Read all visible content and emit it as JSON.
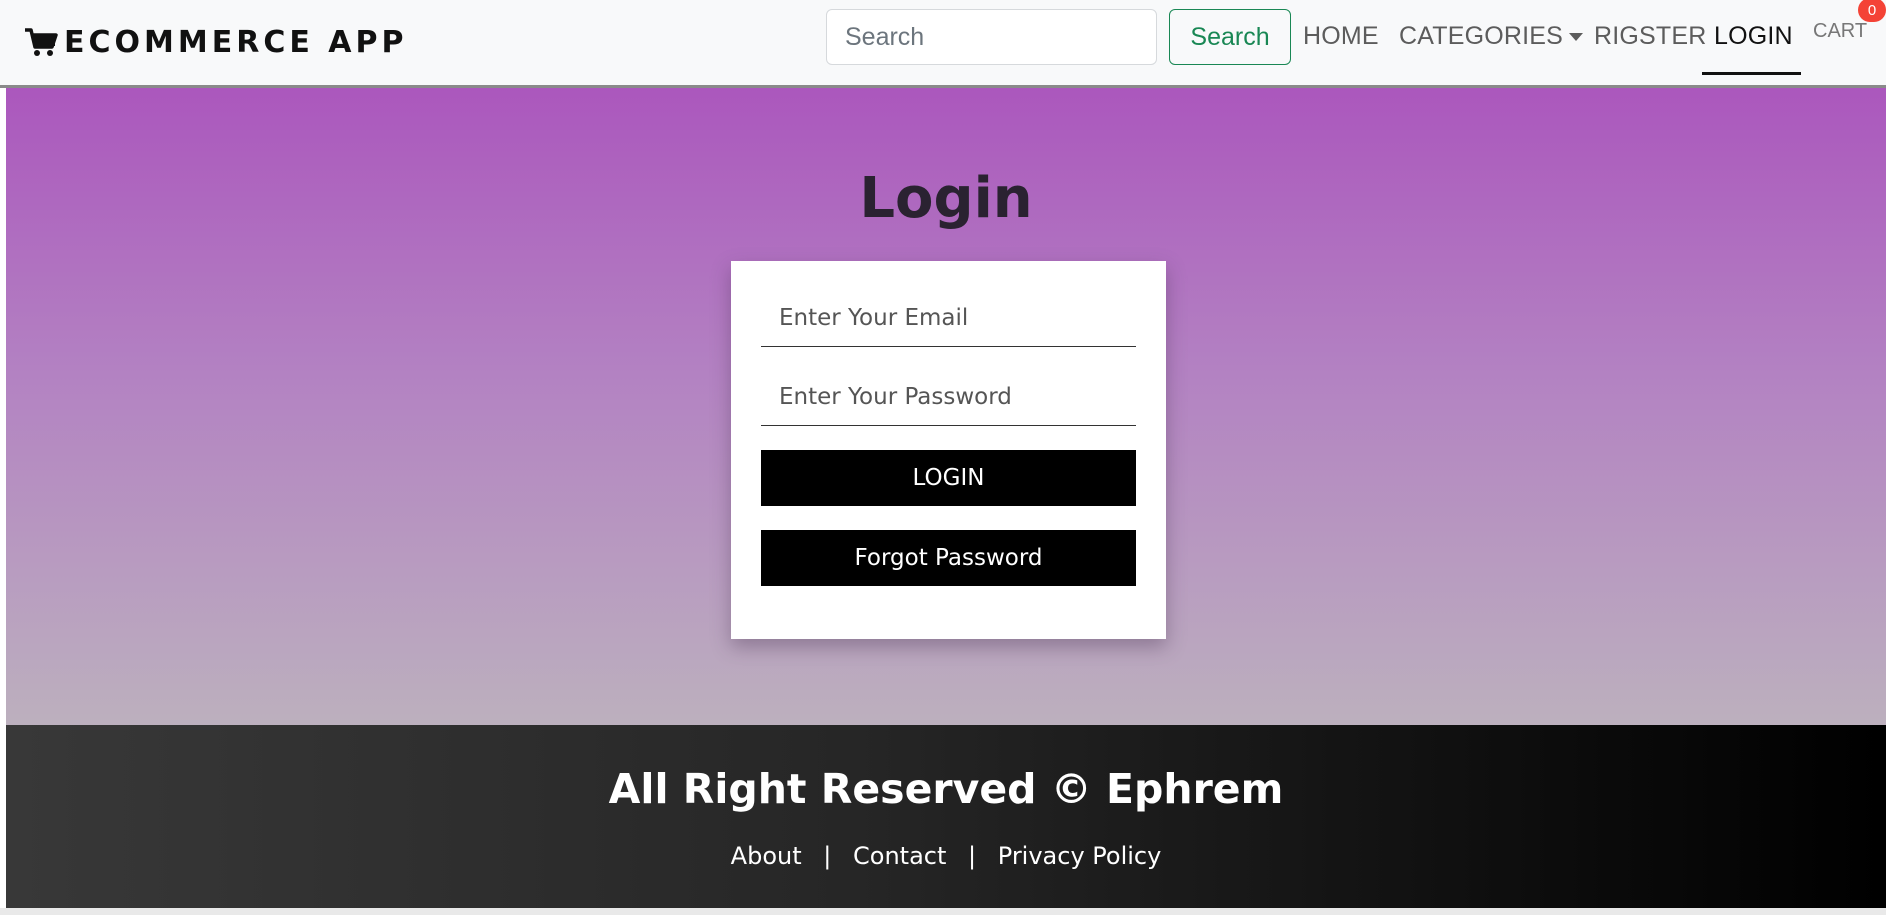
{
  "navbar": {
    "brand": "ECOMMERCE APP",
    "brand_icon": "shopping-cart-icon",
    "search": {
      "placeholder": "Search",
      "value": ""
    },
    "search_button": "Search",
    "links": {
      "home": "HOME",
      "categories": "CATEGORIES",
      "register": "RIGSTER",
      "login": "LOGIN",
      "cart": "CART"
    },
    "cart_count": "0",
    "colors": {
      "search_button": "#198754",
      "badge": "#f44336"
    }
  },
  "login": {
    "title": "Login",
    "email_placeholder": "Enter Your Email",
    "password_placeholder": "Enter Your Password",
    "login_button": "LOGIN",
    "forgot_button": "Forgot Password"
  },
  "footer": {
    "text": "All Right Reserved © Ephrem",
    "links": {
      "about": "About",
      "contact": "Contact",
      "privacy": "Privacy Policy"
    },
    "separator": "|"
  },
  "colors": {
    "gradient_top": "#ab57bd",
    "gradient_bottom": "#bcb0be",
    "button": "#000000"
  }
}
